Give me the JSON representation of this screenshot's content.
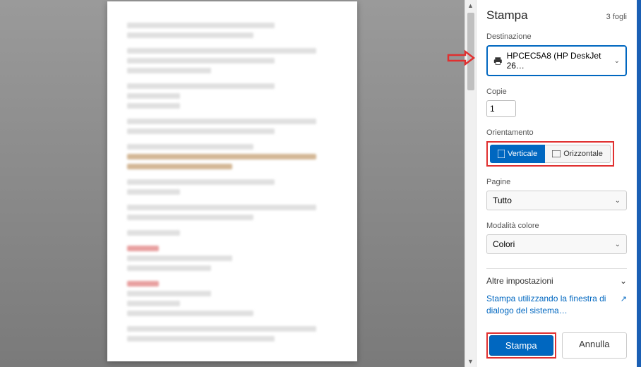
{
  "header": {
    "title": "Stampa",
    "sheets": "3 fogli"
  },
  "destination": {
    "label": "Destinazione",
    "value": "HPCEC5A8 (HP DeskJet 26…"
  },
  "copies": {
    "label": "Copie",
    "value": "1"
  },
  "orientation": {
    "label": "Orientamento",
    "vertical": "Verticale",
    "horizontal": "Orizzontale"
  },
  "pages": {
    "label": "Pagine",
    "value": "Tutto"
  },
  "colorMode": {
    "label": "Modalità colore",
    "value": "Colori"
  },
  "more": {
    "label": "Altre impostazioni"
  },
  "systemDialog": {
    "text": "Stampa utilizzando la finestra di dialogo del sistema…"
  },
  "footer": {
    "print": "Stampa",
    "cancel": "Annulla"
  }
}
